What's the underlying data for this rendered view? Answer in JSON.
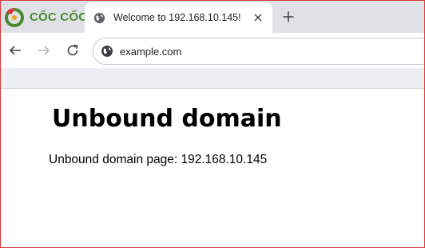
{
  "browser": {
    "logo_text": "CỐC CỐC",
    "tab": {
      "title": "Welcome to 192.168.10.145!",
      "favicon": "globe-icon"
    },
    "toolbar": {
      "url": "example.com",
      "site_icon": "globe-icon",
      "back_icon": "arrow-left-icon",
      "forward_icon": "arrow-right-icon",
      "reload_icon": "reload-icon",
      "new_tab_icon": "plus-icon"
    }
  },
  "page": {
    "heading": "Unbound domain",
    "text": "Unbound domain page: 192.168.10.145"
  },
  "colors": {
    "frame_border": "#d9383a",
    "brand_green": "#4b8a2f",
    "brand_red": "#d9383a"
  }
}
